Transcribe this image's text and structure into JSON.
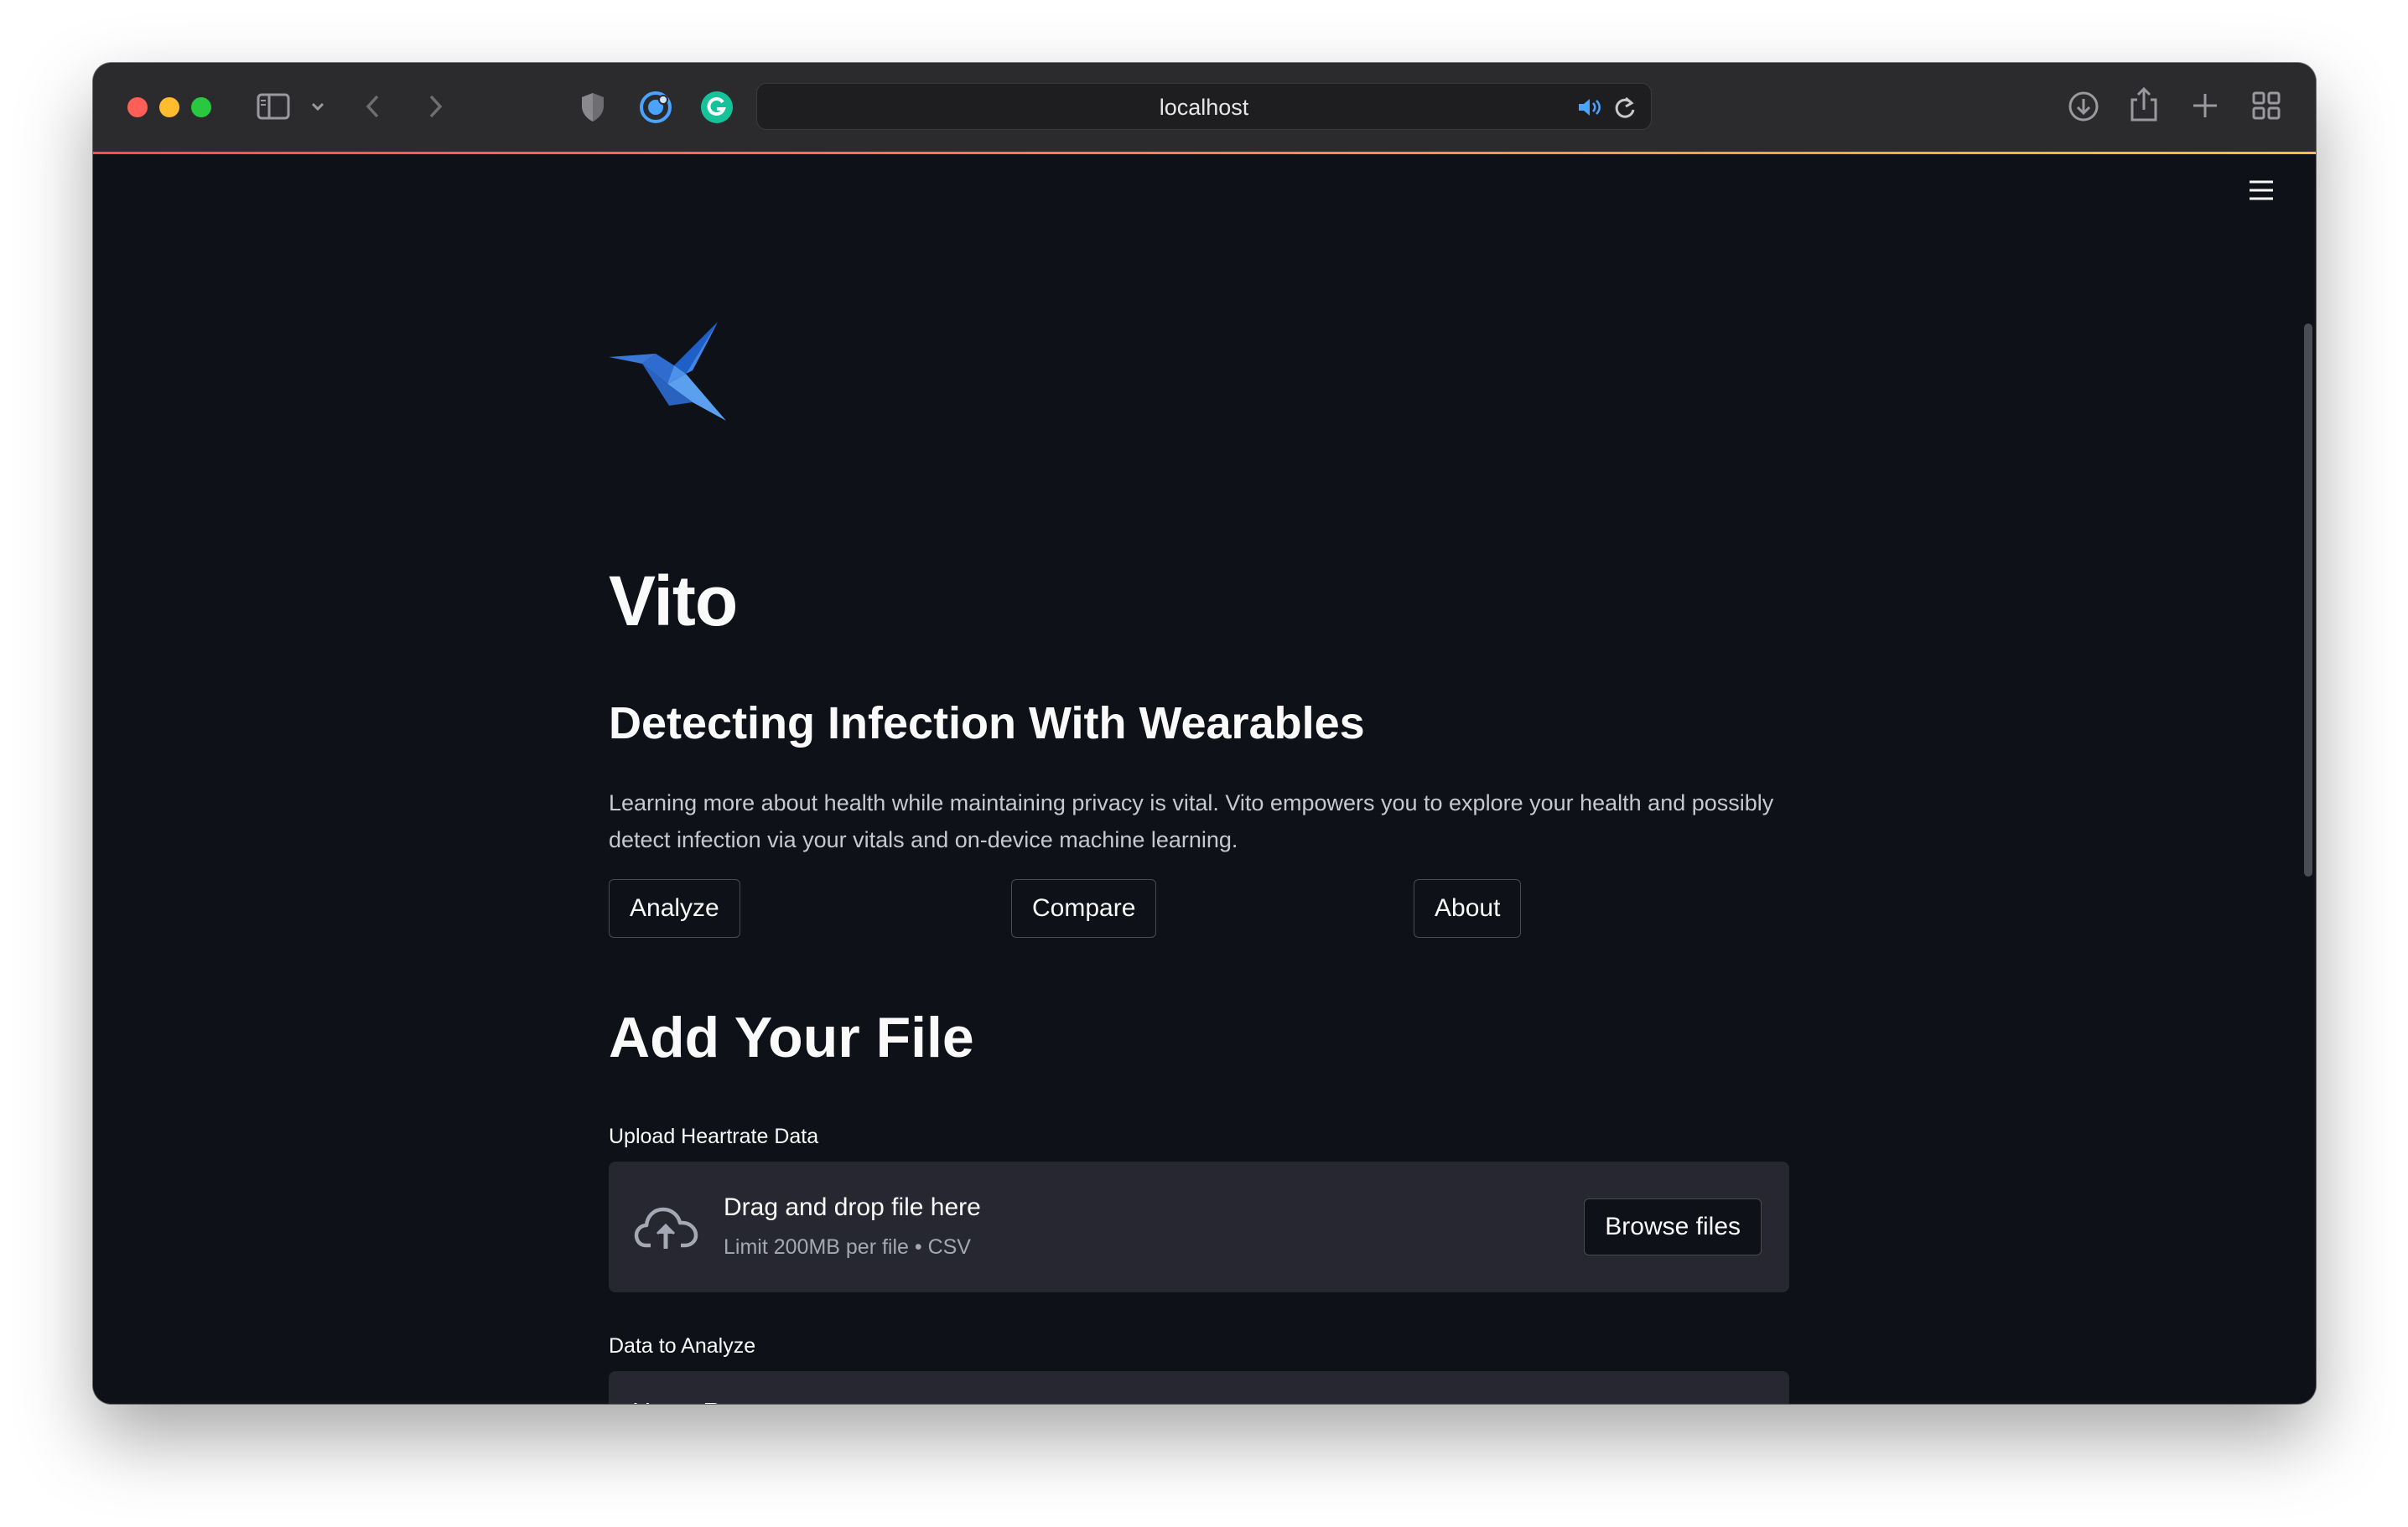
{
  "browser": {
    "url": "localhost"
  },
  "app": {
    "title": "Vito",
    "subtitle": "Detecting Infection With Wearables",
    "description": "Learning more about health while maintaining privacy is vital. Vito empowers you to explore your health and possibly detect infection via your vitals and on-device machine learning.",
    "nav_buttons": [
      "Analyze",
      "Compare",
      "About"
    ]
  },
  "upload": {
    "heading": "Add Your File",
    "label": "Upload Heartrate Data",
    "drop_title": "Drag and drop file here",
    "drop_limit": "Limit 200MB per file • CSV",
    "browse_label": "Browse files"
  },
  "analyze_select": {
    "label": "Data to Analyze",
    "value": "Heart Rate"
  },
  "colors": {
    "background": "#0e1117",
    "widget": "#262730",
    "text": "#fafafa",
    "accent_gradient": [
      "#ff4b4b",
      "#ffbd45"
    ]
  },
  "icons": {
    "logo": "hummingbird-logo",
    "upload": "cloud-upload-icon",
    "menu": "hamburger-menu-icon"
  }
}
